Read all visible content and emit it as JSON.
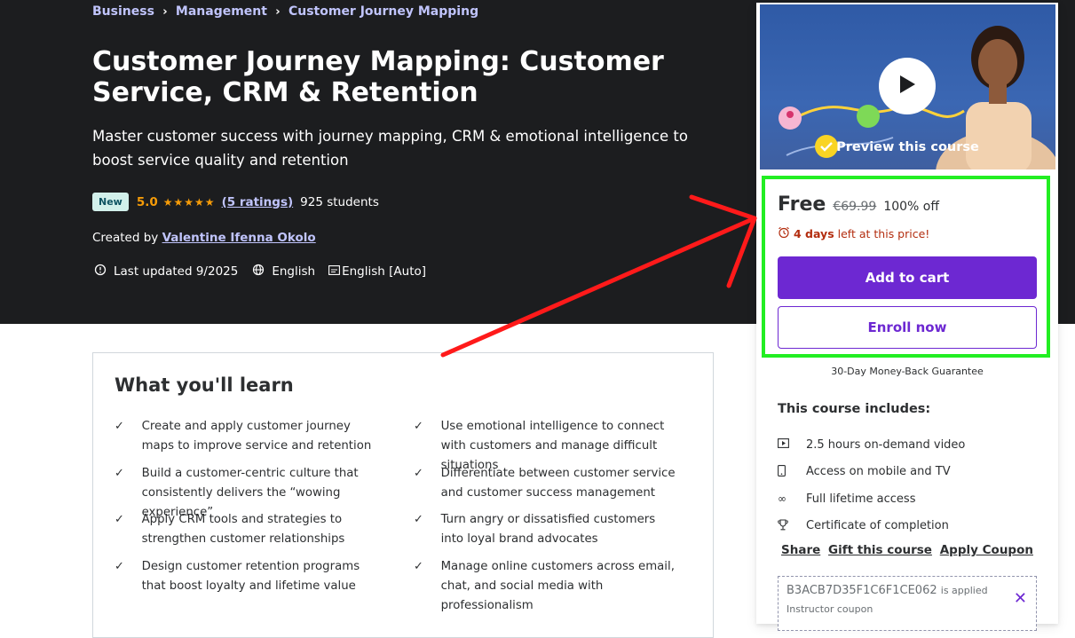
{
  "breadcrumb": [
    "Business",
    "Management",
    "Customer Journey Mapping"
  ],
  "course": {
    "title": "Customer Journey Mapping: Customer Service, CRM & Retention",
    "subtitle": "Master customer success with journey mapping, CRM & emotional intelligence to boost service quality and retention",
    "badge": "New",
    "rating": "5.0",
    "stars": "★★★★★",
    "ratings_count": "(5 ratings)",
    "students": "925 students",
    "created_by_label": "Created by",
    "author": "Valentine Ifenna Okolo",
    "last_updated": "Last updated 9/2025",
    "language": "English",
    "captions": "English [Auto]"
  },
  "sidebar": {
    "preview_label": "Preview this course",
    "price_free": "Free",
    "price_original": "€69.99",
    "price_discount": "100% off",
    "timer_days": "4 days",
    "timer_rest": "left at this price!",
    "add_to_cart": "Add to cart",
    "enroll_now": "Enroll now",
    "guarantee": "30-Day Money-Back Guarantee",
    "includes_title": "This course includes:",
    "includes": [
      {
        "icon": "video-icon",
        "label": "2.5 hours on-demand video"
      },
      {
        "icon": "mobile-icon",
        "label": "Access on mobile and TV"
      },
      {
        "icon": "infinity-icon",
        "label": "Full lifetime access"
      },
      {
        "icon": "trophy-icon",
        "label": "Certificate of completion"
      }
    ],
    "share": "Share",
    "gift": "Gift this course",
    "apply_coupon": "Apply Coupon",
    "coupon_code": "B3ACB7D35F1C6F1CE062",
    "coupon_applied": "is applied",
    "coupon_sub": "Instructor coupon"
  },
  "learn": {
    "title": "What you'll learn",
    "left": [
      "Create and apply customer journey maps to improve service and retention",
      "Build a customer-centric culture that consistently delivers the “wowing experience”",
      "Apply CRM tools and strategies to strengthen customer relationships",
      "Design customer retention programs that boost loyalty and lifetime value"
    ],
    "right": [
      "Use emotional intelligence to connect with customers and manage difficult situations",
      "Differentiate between customer service and customer success management",
      "Turn angry or dissatisfied customers into loyal brand advocates",
      "Manage online customers across email, chat, and social media with professionalism"
    ]
  },
  "colors": {
    "accent": "#6d28d2",
    "highlight_box": "#22ee22",
    "arrow": "#ff1a1a",
    "hero_bg": "#1c1d1f"
  }
}
